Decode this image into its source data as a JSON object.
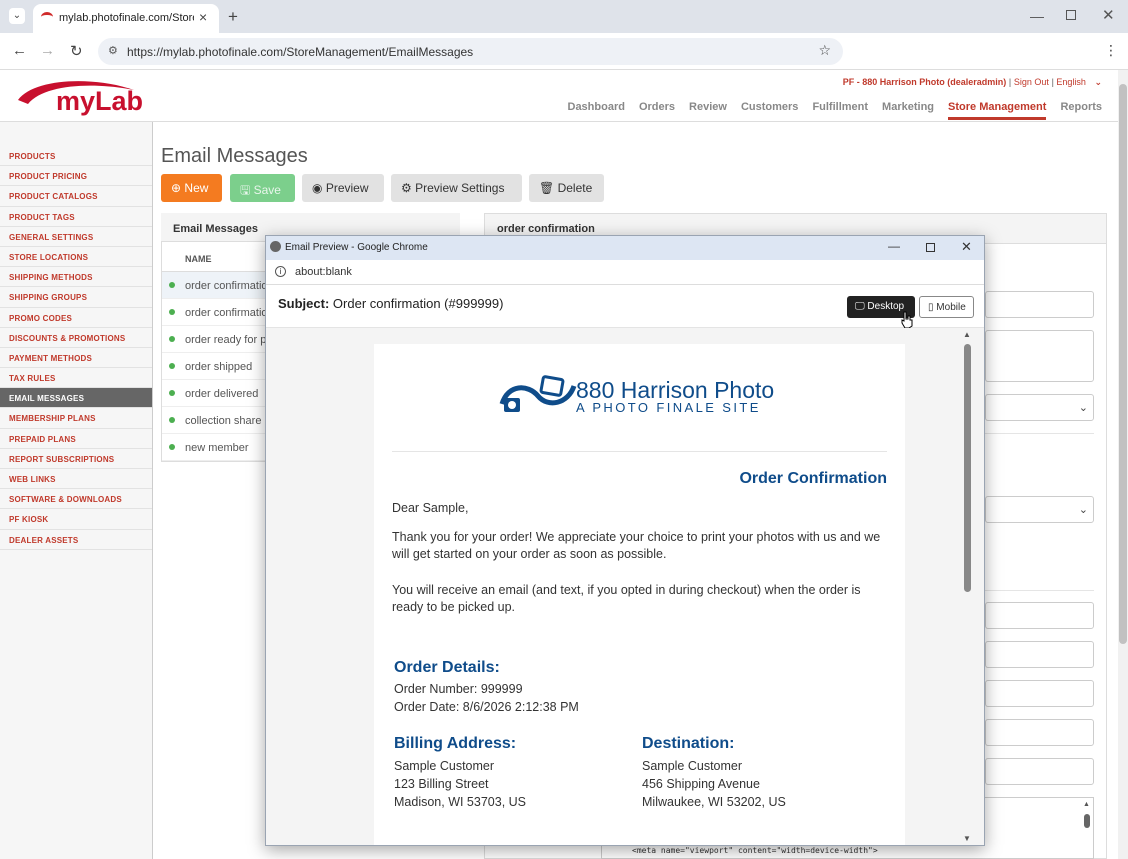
{
  "browser": {
    "tab_title": "mylab.photofinale.com/StoreM",
    "url": "https://mylab.photofinale.com/StoreManagement/EmailMessages"
  },
  "header": {
    "logo_text": "myLab",
    "user_info": "PF - 880 Harrison Photo (dealeradmin)",
    "sign_out": "Sign Out",
    "language": "English",
    "nav": [
      "Dashboard",
      "Orders",
      "Review",
      "Customers",
      "Fulfillment",
      "Marketing",
      "Store Management",
      "Reports"
    ],
    "active_nav": "Store Management"
  },
  "sidebar": {
    "items": [
      "PRODUCTS",
      "PRODUCT PRICING",
      "PRODUCT CATALOGS",
      "PRODUCT TAGS",
      "GENERAL SETTINGS",
      "STORE LOCATIONS",
      "SHIPPING METHODS",
      "SHIPPING GROUPS",
      "PROMO CODES",
      "DISCOUNTS & PROMOTIONS",
      "PAYMENT METHODS",
      "TAX RULES",
      "EMAIL MESSAGES",
      "MEMBERSHIP PLANS",
      "PREPAID PLANS",
      "REPORT SUBSCRIPTIONS",
      "WEB LINKS",
      "SOFTWARE & DOWNLOADS",
      "PF KIOSK",
      "DEALER ASSETS"
    ],
    "active": "EMAIL MESSAGES"
  },
  "main": {
    "title": "Email Messages",
    "toolbar": {
      "new": "New",
      "save": "Save",
      "preview": "Preview",
      "preview_settings": "Preview Settings",
      "delete": "Delete"
    },
    "list_panel_title": "Email Messages",
    "list_column": "NAME",
    "list_items": [
      "order confirmation",
      "order confirmation",
      "order ready for pickup",
      "order shipped",
      "order delivered",
      "collection share",
      "new member"
    ],
    "detail_panel_title": "order confirmation",
    "code_snippet": "<meta name=\"viewport\" content=\"width=device-width\">"
  },
  "popup": {
    "window_title": "Email Preview - Google Chrome",
    "address": "about:blank",
    "subject_label": "Subject:",
    "subject_value": "Order confirmation (#999999)",
    "desktop_label": "Desktop",
    "mobile_label": "Mobile",
    "email": {
      "store_name": "880 Harrison Photo",
      "store_tagline": "A PHOTO FINALE SITE",
      "heading": "Order Confirmation",
      "greeting": "Dear Sample,",
      "para1": "Thank you for your order! We appreciate your choice to print your photos with us and we will get started on your order as soon as possible.",
      "para2": "You will receive an email (and text, if you opted in during checkout) when the order is ready to be picked up.",
      "order_details_title": "Order Details:",
      "order_number": "Order Number: 999999",
      "order_date": "Order Date: 8/6/2026 2:12:38 PM",
      "billing_title": "Billing Address:",
      "billing_lines": [
        "Sample Customer",
        "123 Billing Street",
        "Madison, WI 53703, US"
      ],
      "destination_title": "Destination:",
      "destination_lines": [
        "Sample Customer",
        "456 Shipping Avenue",
        "Milwaukee, WI 53202, US"
      ]
    }
  },
  "colors": {
    "brand_red": "#c0392b",
    "email_blue": "#0f4c8a",
    "new_button": "#f47b20",
    "save_button": "#7ccf8c"
  }
}
